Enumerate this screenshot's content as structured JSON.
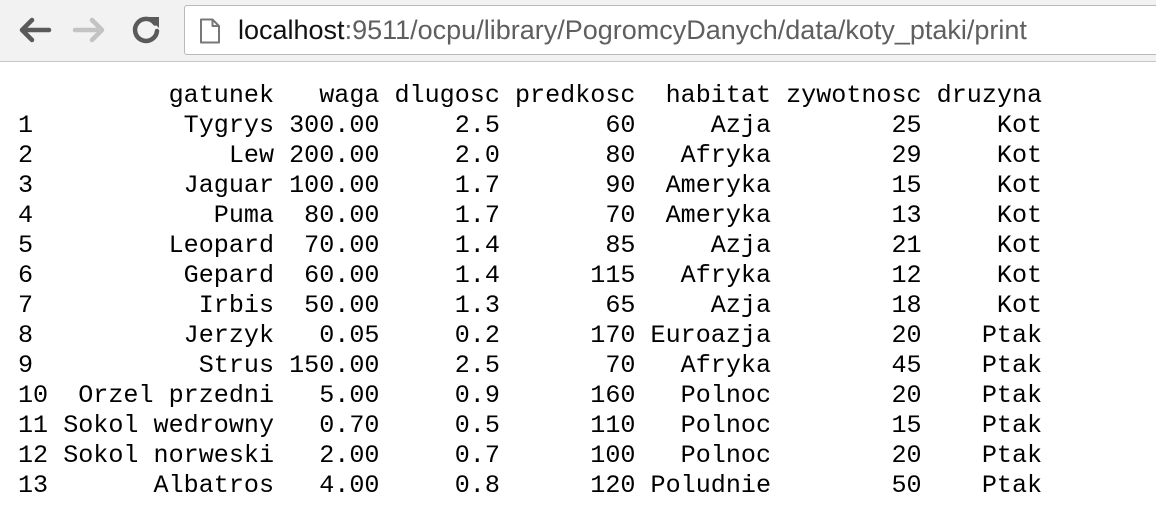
{
  "browser": {
    "url_host": "localhost",
    "url_rest": ":9511/ocpu/library/PogromcyDanych/data/koty_ptaki/print"
  },
  "table": {
    "columns": [
      "gatunek",
      "waga",
      "dlugosc",
      "predkosc",
      "habitat",
      "zywotnosc",
      "druzyna"
    ],
    "rows": [
      {
        "index": "1",
        "gatunek": "Tygrys",
        "waga": "300.00",
        "dlugosc": "2.5",
        "predkosc": "60",
        "habitat": "Azja",
        "zywotnosc": "25",
        "druzyna": "Kot"
      },
      {
        "index": "2",
        "gatunek": "Lew",
        "waga": "200.00",
        "dlugosc": "2.0",
        "predkosc": "80",
        "habitat": "Afryka",
        "zywotnosc": "29",
        "druzyna": "Kot"
      },
      {
        "index": "3",
        "gatunek": "Jaguar",
        "waga": "100.00",
        "dlugosc": "1.7",
        "predkosc": "90",
        "habitat": "Ameryka",
        "zywotnosc": "15",
        "druzyna": "Kot"
      },
      {
        "index": "4",
        "gatunek": "Puma",
        "waga": "80.00",
        "dlugosc": "1.7",
        "predkosc": "70",
        "habitat": "Ameryka",
        "zywotnosc": "13",
        "druzyna": "Kot"
      },
      {
        "index": "5",
        "gatunek": "Leopard",
        "waga": "70.00",
        "dlugosc": "1.4",
        "predkosc": "85",
        "habitat": "Azja",
        "zywotnosc": "21",
        "druzyna": "Kot"
      },
      {
        "index": "6",
        "gatunek": "Gepard",
        "waga": "60.00",
        "dlugosc": "1.4",
        "predkosc": "115",
        "habitat": "Afryka",
        "zywotnosc": "12",
        "druzyna": "Kot"
      },
      {
        "index": "7",
        "gatunek": "Irbis",
        "waga": "50.00",
        "dlugosc": "1.3",
        "predkosc": "65",
        "habitat": "Azja",
        "zywotnosc": "18",
        "druzyna": "Kot"
      },
      {
        "index": "8",
        "gatunek": "Jerzyk",
        "waga": "0.05",
        "dlugosc": "0.2",
        "predkosc": "170",
        "habitat": "Euroazja",
        "zywotnosc": "20",
        "druzyna": "Ptak"
      },
      {
        "index": "9",
        "gatunek": "Strus",
        "waga": "150.00",
        "dlugosc": "2.5",
        "predkosc": "70",
        "habitat": "Afryka",
        "zywotnosc": "45",
        "druzyna": "Ptak"
      },
      {
        "index": "10",
        "gatunek": "Orzel przedni",
        "waga": "5.00",
        "dlugosc": "0.9",
        "predkosc": "160",
        "habitat": "Polnoc",
        "zywotnosc": "20",
        "druzyna": "Ptak"
      },
      {
        "index": "11",
        "gatunek": "Sokol wedrowny",
        "waga": "0.70",
        "dlugosc": "0.5",
        "predkosc": "110",
        "habitat": "Polnoc",
        "zywotnosc": "15",
        "druzyna": "Ptak"
      },
      {
        "index": "12",
        "gatunek": "Sokol norweski",
        "waga": "2.00",
        "dlugosc": "0.7",
        "predkosc": "100",
        "habitat": "Polnoc",
        "zywotnosc": "20",
        "druzyna": "Ptak"
      },
      {
        "index": "13",
        "gatunek": "Albatros",
        "waga": "4.00",
        "dlugosc": "0.8",
        "predkosc": "120",
        "habitat": "Poludnie",
        "zywotnosc": "50",
        "druzyna": "Ptak"
      }
    ]
  }
}
